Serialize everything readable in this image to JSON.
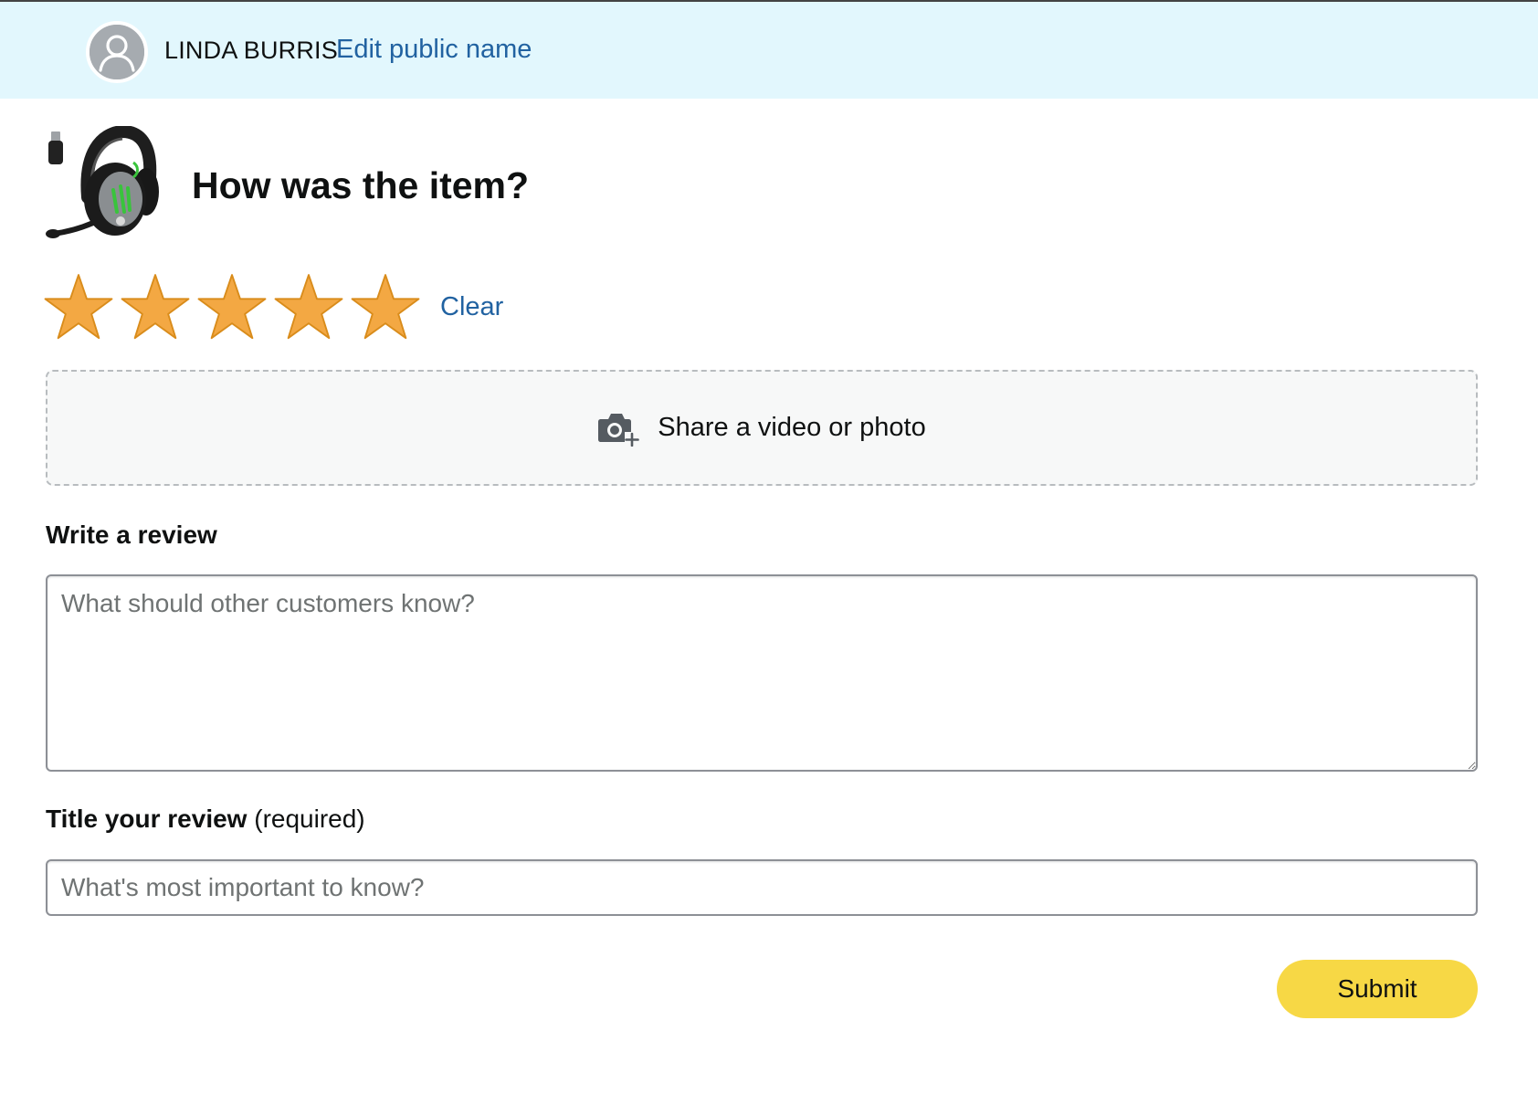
{
  "header": {
    "user_name": "LINDA BURRIS",
    "edit_link": "Edit public name",
    "avatar_icon": "user-avatar-icon"
  },
  "product": {
    "title": "How was the item?",
    "thumbnail": "headset-icon"
  },
  "rating": {
    "value": 5,
    "max": 5,
    "clear_label": "Clear",
    "star_color": "#f3a843",
    "star_outline": "#d98c1b"
  },
  "upload": {
    "label": "Share a video or photo",
    "icon": "camera-plus-icon"
  },
  "review": {
    "label": "Write a review",
    "placeholder": "What should other customers know?",
    "value": ""
  },
  "title_field": {
    "label": "Title your review",
    "note": "(required)",
    "placeholder": "What's most important to know?",
    "value": ""
  },
  "submit": {
    "label": "Submit",
    "color": "#f7d845"
  },
  "colors": {
    "header_bg": "#e2f7fd",
    "link": "#2162a1",
    "text": "#0f1111"
  }
}
